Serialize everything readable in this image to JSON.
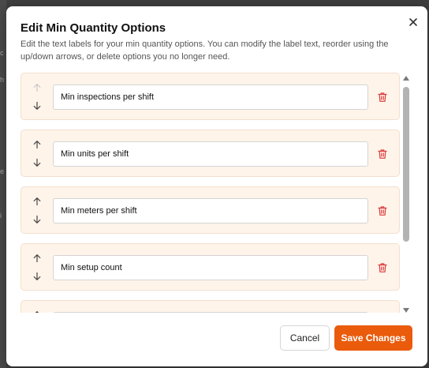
{
  "dialog": {
    "title": "Edit Min Quantity Options",
    "description": "Edit the text labels for your min quantity options. You can modify the label text, reorder using the up/down arrows, or delete options you no longer need.",
    "close_icon": "close-icon"
  },
  "options": [
    {
      "label": "Min inspections per shift",
      "up_enabled": false,
      "down_enabled": true
    },
    {
      "label": "Min units per shift",
      "up_enabled": true,
      "down_enabled": true
    },
    {
      "label": "Min meters per shift",
      "up_enabled": true,
      "down_enabled": true
    },
    {
      "label": "Min setup count",
      "up_enabled": true,
      "down_enabled": true
    },
    {
      "label": "",
      "up_enabled": true,
      "down_enabled": true
    }
  ],
  "icons": {
    "up": "arrow-up-icon",
    "down": "arrow-down-icon",
    "delete": "trash-icon"
  },
  "footer": {
    "cancel_label": "Cancel",
    "save_label": "Save Changes"
  },
  "colors": {
    "accent": "#ea5b0c",
    "row_background": "#fff4ea",
    "delete_icon": "#d93b3b",
    "arrow_active": "#444444",
    "arrow_disabled": "#c8c8c8"
  }
}
